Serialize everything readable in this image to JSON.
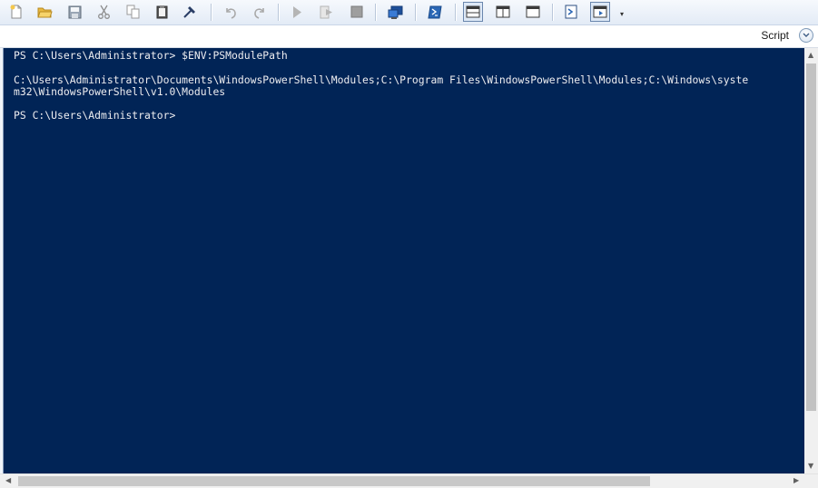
{
  "toolbar": {
    "buttons": [
      {
        "name": "new-icon"
      },
      {
        "name": "open-folder-icon"
      },
      {
        "name": "save-icon"
      },
      {
        "name": "cut-icon"
      },
      {
        "name": "copy-icon"
      },
      {
        "name": "paste-icon"
      },
      {
        "name": "clear-console-icon"
      },
      {
        "name": "undo-icon"
      },
      {
        "name": "redo-icon"
      },
      {
        "name": "run-script-icon"
      },
      {
        "name": "run-selection-icon"
      },
      {
        "name": "stop-icon"
      },
      {
        "name": "new-remote-tab-icon"
      },
      {
        "name": "start-powershell-icon"
      },
      {
        "name": "show-script-pane-top-icon"
      },
      {
        "name": "show-script-pane-right-icon"
      },
      {
        "name": "show-script-pane-maximized-icon"
      },
      {
        "name": "show-command-window-icon"
      },
      {
        "name": "show-command-addon-icon"
      }
    ]
  },
  "script_pane": {
    "label": "Script"
  },
  "console": {
    "lines": [
      "PS C:\\Users\\Administrator> $ENV:PSModulePath",
      "",
      "C:\\Users\\Administrator\\Documents\\WindowsPowerShell\\Modules;C:\\Program Files\\WindowsPowerShell\\Modules;C:\\Windows\\syste",
      "m32\\WindowsPowerShell\\v1.0\\Modules",
      "",
      "PS C:\\Users\\Administrator>"
    ]
  },
  "colors": {
    "console_background": "#012456",
    "console_text": "#eeedf0",
    "toolbar_background": "#e9eff8"
  }
}
